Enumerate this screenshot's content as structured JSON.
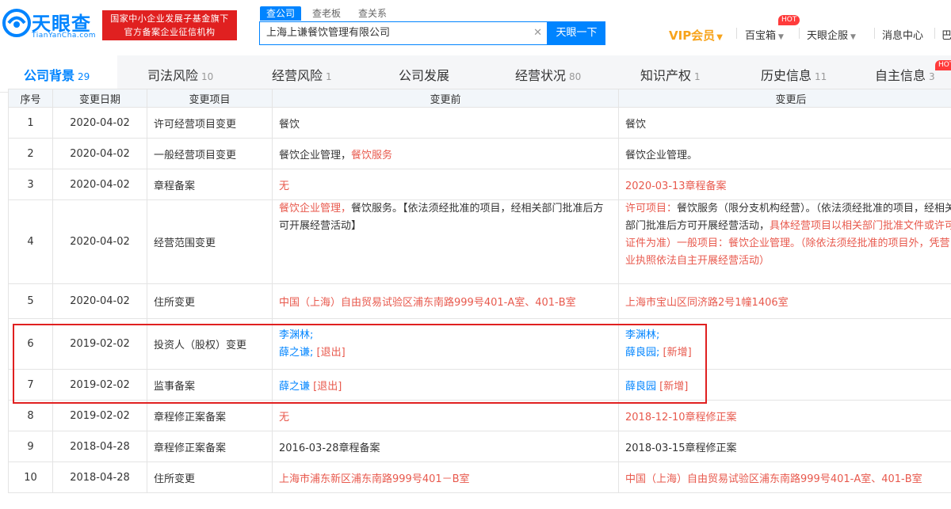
{
  "header": {
    "logo_text": "天眼查",
    "logo_url": "TianYanCha.com",
    "banner_line1": "国家中小企业发展子基金旗下",
    "banner_line2": "官方备案企业征信机构",
    "search_tabs": [
      "查公司",
      "查老板",
      "查关系"
    ],
    "search_value": "上海上谦餐饮管理有限公司",
    "search_button": "天眼一下",
    "vip": "VIP会员",
    "nav": [
      "百宝箱",
      "天眼企服",
      "消息中心",
      "巴"
    ],
    "hot_badge": "HOT"
  },
  "tabs": [
    {
      "label": "公司背景",
      "count": "29"
    },
    {
      "label": "司法风险",
      "count": "10"
    },
    {
      "label": "经营风险",
      "count": "1"
    },
    {
      "label": "公司发展",
      "count": ""
    },
    {
      "label": "经营状况",
      "count": "80"
    },
    {
      "label": "知识产权",
      "count": "1"
    },
    {
      "label": "历史信息",
      "count": "11"
    },
    {
      "label": "自主信息",
      "count": "3"
    }
  ],
  "table": {
    "headers": [
      "序号",
      "变更日期",
      "变更项目",
      "变更前",
      "变更后"
    ],
    "rows": [
      {
        "no": "1",
        "date": "2020-04-02",
        "item": "许可经营项目变更",
        "before": "餐饮",
        "after": "餐饮"
      },
      {
        "no": "2",
        "date": "2020-04-02",
        "item": "一般经营项目变更",
        "before_a": "餐饮企业管理，",
        "before_b": "餐饮服务",
        "after": "餐饮企业管理。"
      },
      {
        "no": "3",
        "date": "2020-04-02",
        "item": "章程备案",
        "before": "无",
        "after": "2020-03-13章程备案"
      },
      {
        "no": "4",
        "date": "2020-04-02",
        "item": "经营范围变更",
        "before_a": "餐饮企业管理，",
        "before_b": "餐饮服务。【依法须经批准的项目，经相关部门批准后方可开展经营活动】",
        "after_a": "许可项目：",
        "after_b": "餐饮服务（限分支机构经营）",
        "after_c": "。（依法须经批准的项目，经相关部门批准后方可开展经营活动，",
        "after_d": "具体经营项目以相关部门批准文件或许可证件为准）一般项目：餐饮企业管理。（除依法须经批准的项目外，凭营业执照依法自主开展经营活动）"
      },
      {
        "no": "5",
        "date": "2020-04-02",
        "item": "住所变更",
        "before": "中国（上海）自由贸易试验区浦东南路999号401-A室、401-B室",
        "after": "上海市宝山区同济路2号1幢1406室"
      },
      {
        "no": "6",
        "date": "2019-02-02",
        "item": "投资人（股权）变更",
        "before_a": "李渊林;",
        "before_b": "薛之谦;",
        "before_c": "[退出]",
        "after_a": "李渊林;",
        "after_b": "薛良园;",
        "after_c": "[新增]"
      },
      {
        "no": "7",
        "date": "2019-02-02",
        "item": "监事备案",
        "before_a": "薛之谦",
        "before_c": "[退出]",
        "after_a": "薛良园",
        "after_c": "[新增]"
      },
      {
        "no": "8",
        "date": "2019-02-02",
        "item": "章程修正案备案",
        "before": "无",
        "after": "2018-12-10章程修正案"
      },
      {
        "no": "9",
        "date": "2018-04-28",
        "item": "章程修正案备案",
        "before": "2016-03-28章程备案",
        "after": "2018-03-15章程修正案"
      },
      {
        "no": "10",
        "date": "2018-04-28",
        "item": "住所变更",
        "before": "上海市浦东新区浦东南路999号401－B室",
        "after": "中国（上海）自由贸易试验区浦东南路999号401-A室、401-B室"
      }
    ]
  }
}
